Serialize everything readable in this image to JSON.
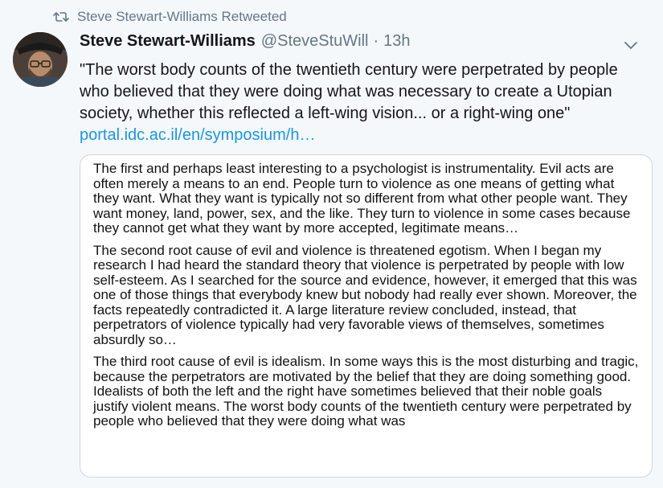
{
  "retweet": {
    "label": "Steve Stewart-Williams Retweeted",
    "icon": "retweet-icon"
  },
  "author": {
    "display_name": "Steve Stewart-Williams",
    "handle": "@SteveStuWill",
    "separator": "·",
    "time": "13h",
    "avatar_icon": "avatar"
  },
  "tweet": {
    "text": "\"The worst body counts of the twentieth century were perpetrated by people who believed that they were doing what was necessary to create a Utopian society, whether this reflected a left-wing vision... or a right-wing one\"",
    "link": "portal.idc.ac.il/en/symposium/h…"
  },
  "menu": {
    "icon": "chevron-down-icon"
  },
  "image_excerpt": {
    "paragraphs": [
      "The first and perhaps least interesting to a psychologist is instrumentality. Evil acts are often merely a means to an end. People turn to violence as one means of getting what they want. What they want is typically not so different from what other people want. They want money, land, power, sex, and the like. They turn to violence in some cases because they cannot get what they want by more accepted, legitimate means…",
      "The second root cause of evil and violence is threatened egotism. When I began my research I had heard the standard theory that violence is perpetrated by people with low self-esteem. As I searched for the source and evidence, however, it emerged that this was one of those things that everybody knew but nobody had really ever shown. Moreover, the facts repeatedly contradicted it. A large literature review concluded, instead, that perpetrators of violence typically had very favorable views of themselves, sometimes absurdly so…",
      "The third root cause of evil is idealism. In some ways this is the most disturbing and tragic, because the perpetrators are motivated by the belief that they are doing something good. Idealists of both the left and the right have sometimes believed that their noble goals justify violent means. The worst body counts of the twentieth century were perpetrated by people who believed that they were doing what was"
    ]
  },
  "colors": {
    "background": "#f5f8fa",
    "secondary_text": "#657786",
    "link": "#1b95e0",
    "border": "#ccd6dd"
  }
}
